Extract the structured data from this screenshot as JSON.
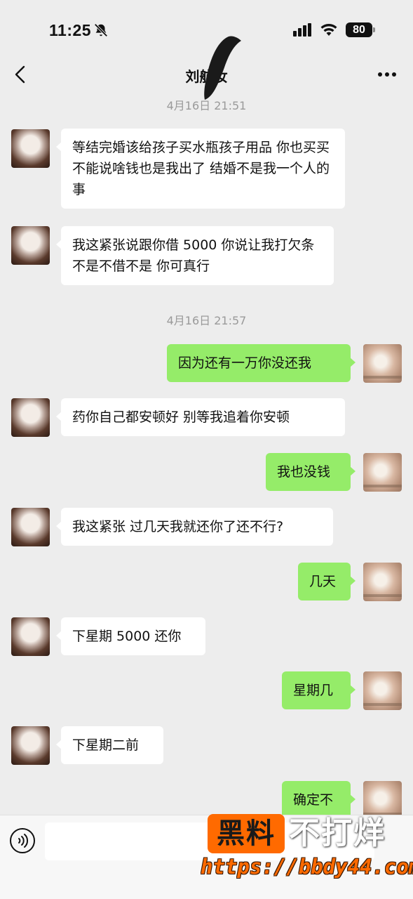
{
  "status_bar": {
    "time": "11:25",
    "battery": "80",
    "icons": [
      "bell-slash-icon",
      "signal-icon",
      "wifi-icon",
      "battery-icon"
    ]
  },
  "nav": {
    "back_icon": "chevron-left-icon",
    "title": "刘航汝",
    "more_icon": "more-dots-icon"
  },
  "timestamps": {
    "t1": "4月16日 21:51",
    "t2": "4月16日 21:57"
  },
  "messages": [
    {
      "sender": "contact",
      "text": "等结完婚该给孩子买水瓶孩子用品 你也买买 不能说啥钱也是我出了 结婚不是我一个人的事"
    },
    {
      "sender": "contact",
      "text": "我这紧张说跟你借 5000 你说让我打欠条不是不借不是 你可真行"
    },
    {
      "sender": "me",
      "text": "因为还有一万你没还我"
    },
    {
      "sender": "contact",
      "text": "药你自己都安顿好 别等我追着你安顿"
    },
    {
      "sender": "me",
      "text": "我也没钱"
    },
    {
      "sender": "contact",
      "text": "我这紧张 过几天我就还你了还不行?"
    },
    {
      "sender": "me",
      "text": "几天"
    },
    {
      "sender": "contact",
      "text": "下星期 5000 还你"
    },
    {
      "sender": "me",
      "text": "星期几"
    },
    {
      "sender": "contact",
      "text": "下星期二前"
    },
    {
      "sender": "me",
      "text": "确定不"
    }
  ],
  "input_bar": {
    "voice_icon": "voice-icon",
    "placeholder": ""
  },
  "watermark": {
    "badge": "黑料",
    "text": "不打烊",
    "url": "https://bbdy44.com"
  },
  "colors": {
    "background": "#ededed",
    "outgoing_bubble": "#95ec69",
    "incoming_bubble": "#ffffff",
    "timestamp": "#9a9a9a",
    "watermark_orange": "#ff6a00"
  }
}
